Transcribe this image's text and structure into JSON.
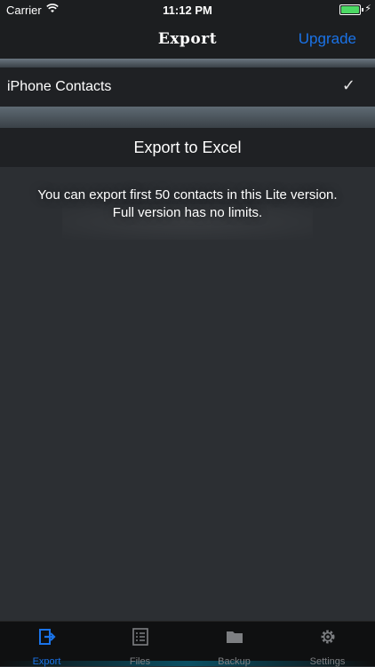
{
  "status_bar": {
    "carrier": "Carrier",
    "time": "11:12 PM"
  },
  "nav": {
    "title": "Export",
    "upgrade_label": "Upgrade"
  },
  "rows": {
    "contacts_label": "iPhone Contacts",
    "export_label": "Export to Excel"
  },
  "note": {
    "line1": "You can export first 50 contacts in this Lite version.",
    "line2": "Full version has no limits."
  },
  "tabs": [
    {
      "label": "Export",
      "icon": "export-icon",
      "active": true
    },
    {
      "label": "Files",
      "icon": "list-icon",
      "active": false
    },
    {
      "label": "Backup",
      "icon": "folder-icon",
      "active": false
    },
    {
      "label": "Settings",
      "icon": "gear-icon",
      "active": false
    }
  ],
  "colors": {
    "accent": "#1a73e8",
    "background": "#2c2f33",
    "bar": "#1c1e20",
    "battery": "#4cd964"
  }
}
